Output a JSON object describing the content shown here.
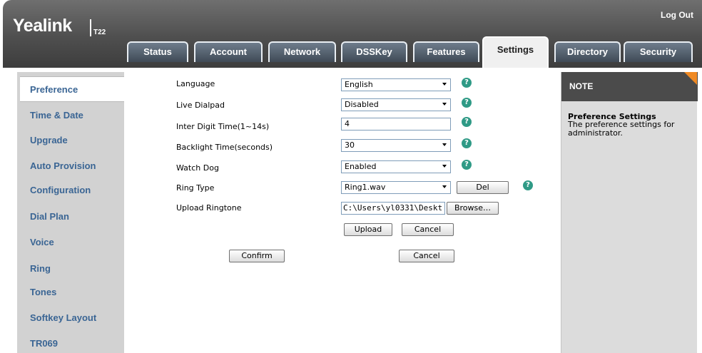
{
  "header": {
    "brand": "Yealink",
    "model": "T22",
    "logout_label": "Log Out"
  },
  "tabs": [
    {
      "label": "Status",
      "active": false
    },
    {
      "label": "Account",
      "active": false
    },
    {
      "label": "Network",
      "active": false
    },
    {
      "label": "DSSKey",
      "active": false
    },
    {
      "label": "Features",
      "active": false
    },
    {
      "label": "Settings",
      "active": true
    },
    {
      "label": "Directory",
      "active": false
    },
    {
      "label": "Security",
      "active": false
    }
  ],
  "sidebar": {
    "items": [
      {
        "label": "Preference",
        "active": true
      },
      {
        "label": "Time & Date",
        "active": false
      },
      {
        "label": "Upgrade",
        "active": false
      },
      {
        "label": "Auto Provision",
        "active": false
      },
      {
        "label": "Configuration",
        "active": false
      },
      {
        "label": "Dial Plan",
        "active": false
      },
      {
        "label": "Voice",
        "active": false
      },
      {
        "label": "Ring",
        "active": false
      },
      {
        "label": "Tones",
        "active": false
      },
      {
        "label": "Softkey Layout",
        "active": false
      },
      {
        "label": "TR069",
        "active": false
      }
    ]
  },
  "form": {
    "language": {
      "label": "Language",
      "value": "English"
    },
    "live_dialpad": {
      "label": "Live Dialpad",
      "value": "Disabled"
    },
    "inter_digit_time": {
      "label": "Inter Digit Time(1~14s)",
      "value": "4"
    },
    "backlight_time": {
      "label": "Backlight Time(seconds)",
      "value": "30"
    },
    "watch_dog": {
      "label": "Watch Dog",
      "value": "Enabled"
    },
    "ring_type": {
      "label": "Ring Type",
      "value": "Ring1.wav",
      "del_label": "Del"
    },
    "upload_ringtone": {
      "label": "Upload Ringtone",
      "path": "C:\\Users\\yl0331\\Deskt",
      "browse_label": "Browse…",
      "upload_label": "Upload",
      "cancel_label": "Cancel"
    },
    "help_glyph": "?",
    "confirm_label": "Confirm",
    "cancel_label": "Cancel"
  },
  "note": {
    "header": "NOTE",
    "title": "Preference Settings",
    "body": "The preference settings for administrator."
  },
  "colors": {
    "accent_orange": "#f08a24",
    "nav_text": "#3a6594",
    "help_icon": "#2f9a86"
  }
}
